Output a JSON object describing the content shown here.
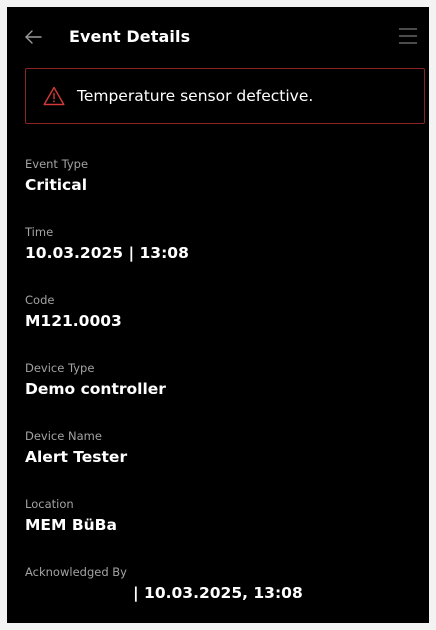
{
  "header": {
    "back_icon": "arrow-left-icon",
    "title": "Event Details",
    "menu_icon": "hamburger-menu-icon"
  },
  "alert": {
    "icon": "warning-triangle-icon",
    "message": "Temperature sensor defective.",
    "border_color": "#8c2424",
    "icon_color": "#d23a3a"
  },
  "fields": {
    "event_type": {
      "label": "Event Type",
      "value": "Critical"
    },
    "time": {
      "label": "Time",
      "value": "10.03.2025 | 13:08"
    },
    "code": {
      "label": "Code",
      "value": "M121.0003"
    },
    "device_type": {
      "label": "Device Type",
      "value": "Demo controller"
    },
    "device_name": {
      "label": "Device Name",
      "value": "Alert Tester"
    },
    "location": {
      "label": "Location",
      "value": "MEM BüBa"
    },
    "acknowledged_by": {
      "label": "Acknowledged By",
      "value": "| 10.03.2025, 13:08"
    }
  },
  "colors": {
    "background": "#000000",
    "outer_background": "#f3f3f3",
    "label": "#a3a3a3",
    "value": "#ffffff"
  }
}
